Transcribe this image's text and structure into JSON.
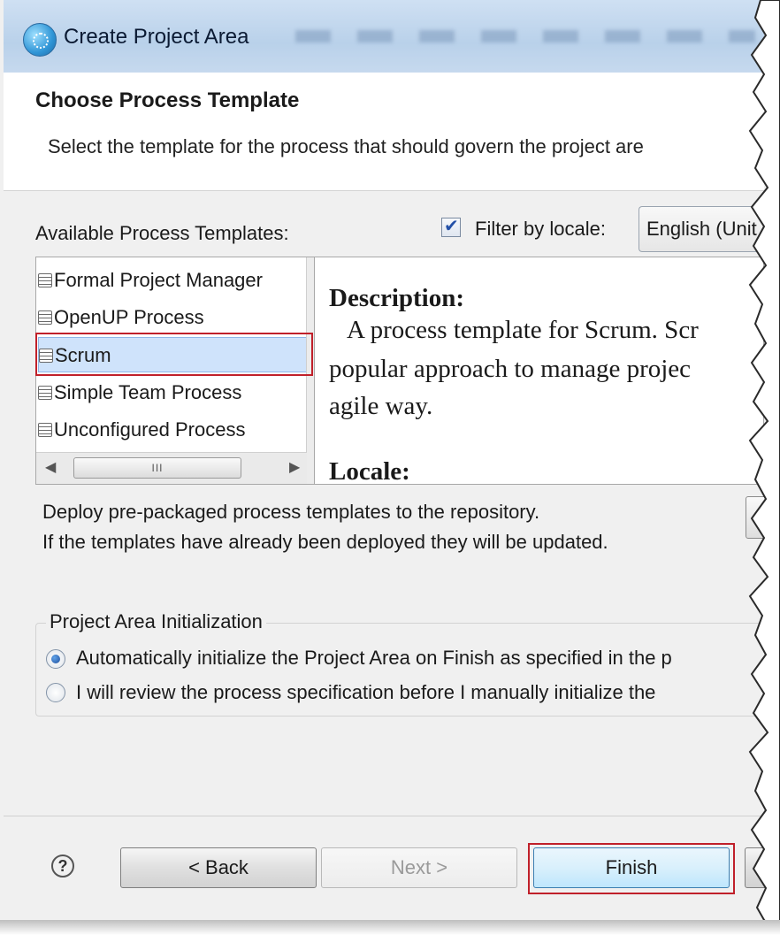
{
  "window": {
    "title": "Create Project Area"
  },
  "header": {
    "title": "Choose Process Template",
    "description": "Select the template for the process that should govern the project are"
  },
  "templates": {
    "label": "Available Process Templates:",
    "filter_label": "Filter by locale:",
    "filter_checked": true,
    "locale_value": "English (Unit",
    "items": [
      {
        "label": "Formal Project Manager"
      },
      {
        "label": "OpenUP Process"
      },
      {
        "label": "Scrum"
      },
      {
        "label": "Simple Team Process"
      },
      {
        "label": "Unconfigured Process"
      }
    ],
    "selected": "Scrum"
  },
  "description_panel": {
    "heading": "Description:",
    "lines": [
      "A process template for Scrum. Scr",
      "popular approach to manage projec",
      "agile way."
    ],
    "locale_heading": "Locale:"
  },
  "deploy": {
    "line1": "Deploy pre-packaged process templates to the repository.",
    "line2": "If the templates have already been deployed they will be updated."
  },
  "initialization": {
    "group_label": "Project Area Initialization",
    "options": [
      {
        "label": "Automatically initialize the Project Area on Finish as specified in the p",
        "selected": true
      },
      {
        "label": "I will review the process specification before I manually initialize the",
        "selected": false
      }
    ]
  },
  "footer": {
    "help": "?",
    "back": "< Back",
    "next": "Next >",
    "finish": "Finish"
  },
  "colors": {
    "highlight": "#c0202a",
    "selection": "#cfe3fb",
    "titlebar": "#b9d1ea"
  }
}
